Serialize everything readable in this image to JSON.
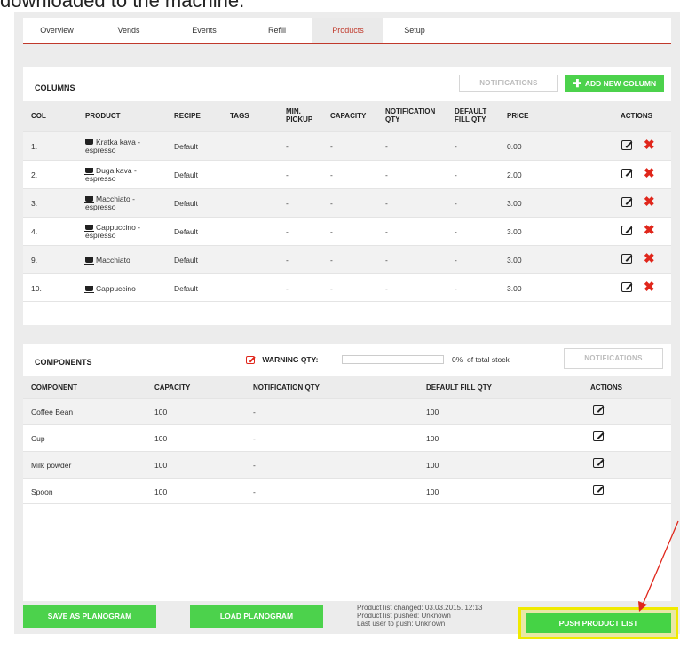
{
  "caption": "downloaded to the machine.",
  "tabs": [
    {
      "label": "Overview"
    },
    {
      "label": "Vends"
    },
    {
      "label": "Events"
    },
    {
      "label": "Refill"
    },
    {
      "label": "Products",
      "active": true
    },
    {
      "label": "Setup"
    }
  ],
  "columns": {
    "title": "COLUMNS",
    "notifications_label": "NOTIFICATIONS",
    "add_label": "ADD NEW COLUMN",
    "headers": {
      "col": "COL",
      "product": "PRODUCT",
      "recipe": "RECIPE",
      "tags": "TAGS",
      "min_pickup_1": "MIN.",
      "min_pickup_2": "PICKUP",
      "capacity": "CAPACITY",
      "notif_1": "NOTIFICATION",
      "notif_2": "QTY",
      "fill_1": "DEFAULT",
      "fill_2": "FILL QTY",
      "price": "PRICE",
      "actions": "ACTIONS"
    },
    "rows": [
      {
        "col": "1.",
        "product_1": "Kratka kava -",
        "product_2": "espresso",
        "recipe": "Default",
        "min_pickup": "-",
        "capacity": "-",
        "notification": "-",
        "fill": "-",
        "price": "0.00"
      },
      {
        "col": "2.",
        "product_1": "Duga kava -",
        "product_2": "espresso",
        "recipe": "Default",
        "min_pickup": "-",
        "capacity": "-",
        "notification": "-",
        "fill": "-",
        "price": "2.00"
      },
      {
        "col": "3.",
        "product_1": "Macchiato -",
        "product_2": "espresso",
        "recipe": "Default",
        "min_pickup": "-",
        "capacity": "-",
        "notification": "-",
        "fill": "-",
        "price": "3.00"
      },
      {
        "col": "4.",
        "product_1": "Cappuccino -",
        "product_2": "espresso",
        "recipe": "Default",
        "min_pickup": "-",
        "capacity": "-",
        "notification": "-",
        "fill": "-",
        "price": "3.00"
      },
      {
        "col": "9.",
        "product_1": "Macchiato",
        "product_2": "",
        "recipe": "Default",
        "min_pickup": "-",
        "capacity": "-",
        "notification": "-",
        "fill": "-",
        "price": "3.00"
      },
      {
        "col": "10.",
        "product_1": "Cappuccino",
        "product_2": "",
        "recipe": "Default",
        "min_pickup": "-",
        "capacity": "-",
        "notification": "-",
        "fill": "-",
        "price": "3.00"
      }
    ]
  },
  "components": {
    "title": "COMPONENTS",
    "warning_label": "WARNING QTY:",
    "warning_value": "",
    "warning_percent": "0%",
    "warning_suffix": "of total stock",
    "notifications_label": "NOTIFICATIONS",
    "headers": {
      "component": "COMPONENT",
      "capacity": "CAPACITY",
      "notification": "NOTIFICATION QTY",
      "fill": "DEFAULT FILL QTY",
      "actions": "ACTIONS"
    },
    "rows": [
      {
        "name": "Coffee Bean",
        "capacity": "100",
        "notification": "-",
        "fill": "100"
      },
      {
        "name": "Cup",
        "capacity": "100",
        "notification": "-",
        "fill": "100"
      },
      {
        "name": "Milk powder",
        "capacity": "100",
        "notification": "-",
        "fill": "100"
      },
      {
        "name": "Spoon",
        "capacity": "100",
        "notification": "-",
        "fill": "100"
      }
    ]
  },
  "footer": {
    "save_label": "SAVE AS PLANOGRAM",
    "load_label": "LOAD PLANOGRAM",
    "changed": "Product list changed: 03.03.2015. 12:13",
    "pushed": "Product list pushed: Unknown",
    "last_user": "Last user to push: Unknown",
    "push_label": "PUSH PRODUCT LIST"
  },
  "colors": {
    "accent_red": "#c0392b",
    "green": "#4cd24c",
    "delete_red": "#e0261b",
    "highlight_yellow": "#f0ea00",
    "arrow_red": "#e0261b"
  }
}
